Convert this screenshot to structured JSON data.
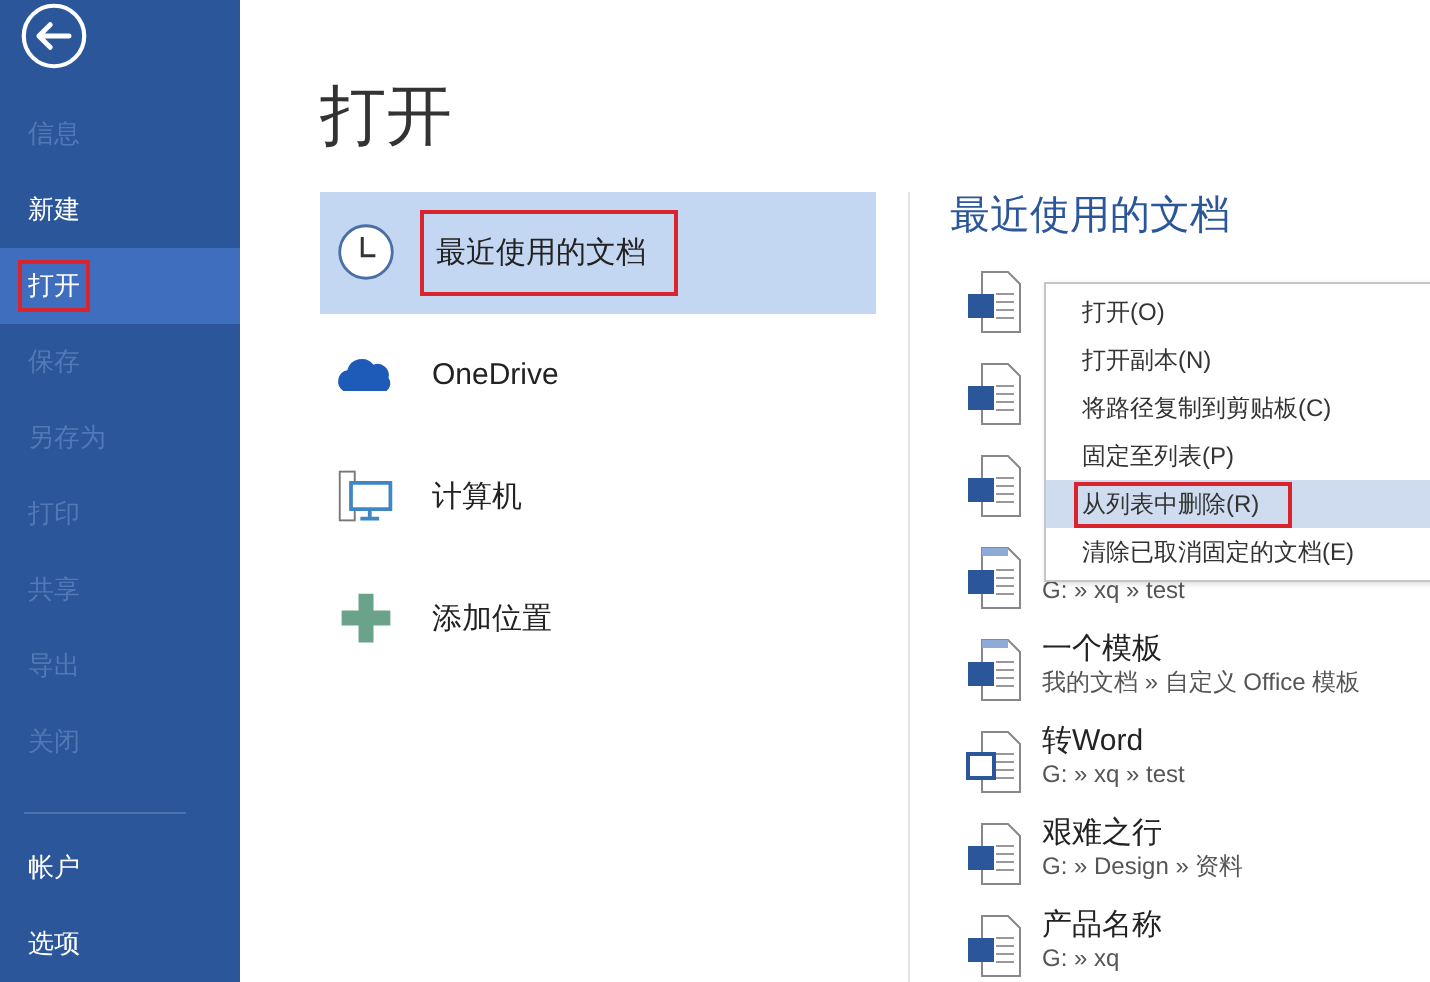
{
  "sidebar": {
    "items": [
      {
        "label": "信息",
        "disabled": true,
        "selected": false,
        "annotated": false
      },
      {
        "label": "新建",
        "disabled": false,
        "selected": false,
        "annotated": false
      },
      {
        "label": "打开",
        "disabled": false,
        "selected": true,
        "annotated": true
      },
      {
        "label": "保存",
        "disabled": true,
        "selected": false,
        "annotated": false
      },
      {
        "label": "另存为",
        "disabled": true,
        "selected": false,
        "annotated": false
      },
      {
        "label": "打印",
        "disabled": true,
        "selected": false,
        "annotated": false
      },
      {
        "label": "共享",
        "disabled": true,
        "selected": false,
        "annotated": false
      },
      {
        "label": "导出",
        "disabled": true,
        "selected": false,
        "annotated": false
      },
      {
        "label": "关闭",
        "disabled": true,
        "selected": false,
        "annotated": false
      }
    ],
    "bottom_items": [
      {
        "label": "帐户",
        "disabled": false,
        "selected": false,
        "annotated": false
      },
      {
        "label": "选项",
        "disabled": false,
        "selected": false,
        "annotated": false
      }
    ]
  },
  "page_title": "打开",
  "places": [
    {
      "kind": "recent",
      "label": "最近使用的文档",
      "selected": true,
      "annotated": true
    },
    {
      "kind": "cloud",
      "label": "OneDrive",
      "selected": false,
      "annotated": false
    },
    {
      "kind": "computer",
      "label": "计算机",
      "selected": false,
      "annotated": false
    },
    {
      "kind": "add",
      "label": "添加位置",
      "selected": false,
      "annotated": false
    }
  ],
  "recent": {
    "heading": "最近使用的文档",
    "items": [
      {
        "kind": "doc"
      },
      {
        "kind": "doc"
      },
      {
        "kind": "doc"
      },
      {
        "kind": "template",
        "path": "G: » xq » test"
      },
      {
        "kind": "template",
        "name": "一个模板",
        "path": "我的文档 » 自定义 Office 模板"
      },
      {
        "kind": "legacy",
        "name": "转Word",
        "path": "G: » xq » test"
      },
      {
        "kind": "doc",
        "name": "艰难之行",
        "path": "G: » Design » 资料"
      },
      {
        "kind": "doc",
        "name": "产品名称",
        "path": "G: » xq"
      }
    ]
  },
  "context_menu": {
    "items": [
      {
        "label": "打开(O)",
        "selected": false,
        "annotated": false
      },
      {
        "label": "打开副本(N)",
        "selected": false,
        "annotated": false
      },
      {
        "label": "将路径复制到剪贴板(C)",
        "selected": false,
        "annotated": false
      },
      {
        "label": "固定至列表(P)",
        "selected": false,
        "annotated": false
      },
      {
        "label": "从列表中删除(R)",
        "selected": true,
        "annotated": true
      },
      {
        "label": "清除已取消固定的文档(E)",
        "selected": false,
        "annotated": false
      }
    ]
  }
}
